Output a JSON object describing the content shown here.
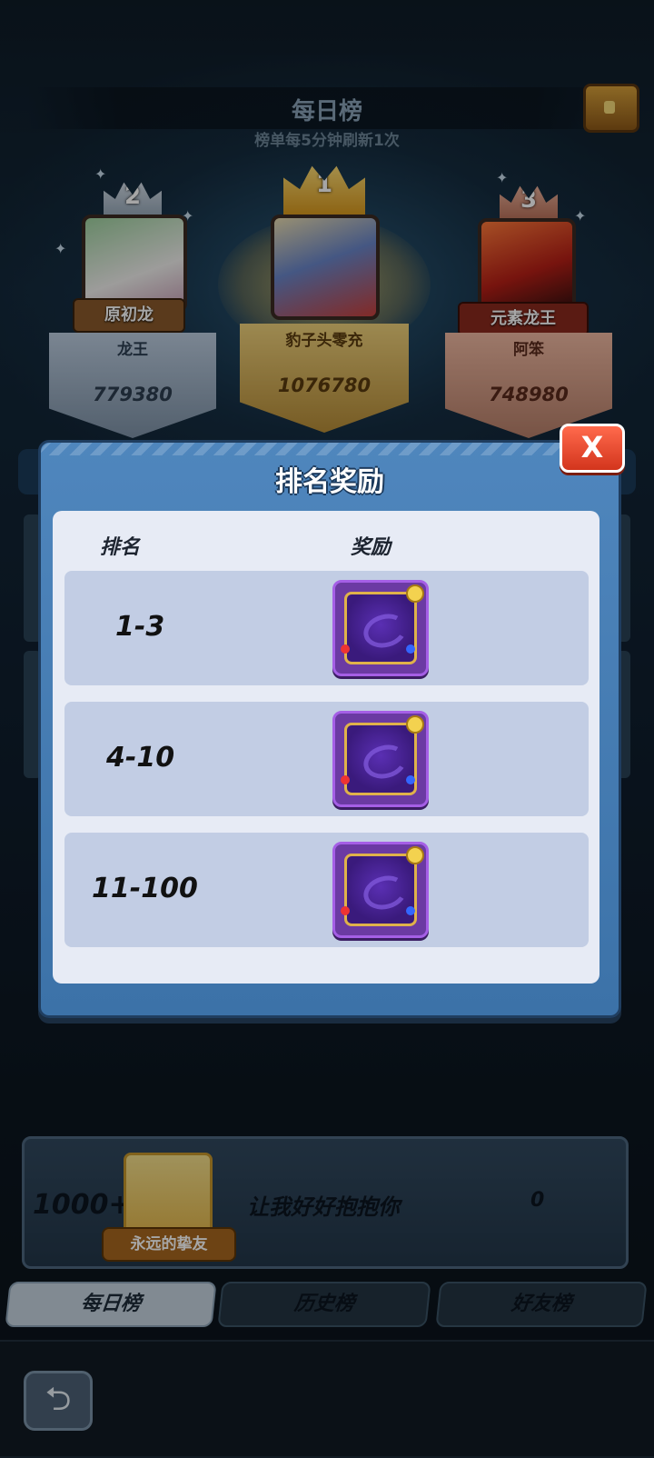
{
  "header": {
    "title": "每日榜",
    "subtitle": "榜单每5分钟刷新1次",
    "chest_icon": "treasure-chest-icon"
  },
  "podium": [
    {
      "rank": "2",
      "badge": "原初龙",
      "name": "龙王",
      "score": "779380"
    },
    {
      "rank": "1",
      "badge": "",
      "name": "豹子头零充",
      "score": "1076780"
    },
    {
      "rank": "3",
      "badge": "元素龙王",
      "name": "阿笨",
      "score": "748980"
    }
  ],
  "modal": {
    "title": "排名奖励",
    "close_label": "X",
    "col_rank": "排名",
    "col_reward": "奖励",
    "rows": [
      {
        "rank": "1-3"
      },
      {
        "rank": "4-10"
      },
      {
        "rank": "11-100"
      }
    ]
  },
  "me": {
    "position": "1000+",
    "tag": "永远的挚友",
    "name": "让我好好抱抱你",
    "score": "0"
  },
  "tabs": [
    "每日榜",
    "历史榜",
    "好友榜"
  ],
  "back_icon": "back-arrow-icon",
  "colors": {
    "modal_blue": "#4f86bd",
    "close_red": "#e0462a",
    "reward_purple": "#6b3aa3"
  }
}
